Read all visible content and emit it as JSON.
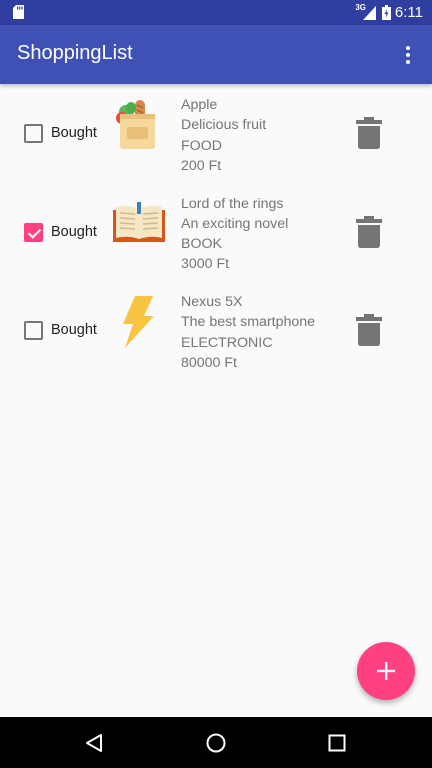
{
  "status_bar": {
    "network": "3G",
    "time": "6:11"
  },
  "app_bar": {
    "title": "ShoppingList"
  },
  "items": [
    {
      "bought_label": "Bought",
      "checked": false,
      "icon": "grocery-bag-icon",
      "name": "Apple",
      "description": "Delicious fruit",
      "category": "FOOD",
      "price": "200 Ft"
    },
    {
      "bought_label": "Bought",
      "checked": true,
      "icon": "open-book-icon",
      "name": "Lord of the rings",
      "description": "An exciting novel",
      "category": "BOOK",
      "price": "3000 Ft"
    },
    {
      "bought_label": "Bought",
      "checked": false,
      "icon": "lightning-bolt-icon",
      "name": "Nexus 5X",
      "description": "The best smartphone",
      "category": "ELECTRONIC",
      "price": "80000 Ft"
    }
  ],
  "colors": {
    "primary": "#3f51b5",
    "primary_dark": "#303f9f",
    "accent": "#ff4081"
  }
}
